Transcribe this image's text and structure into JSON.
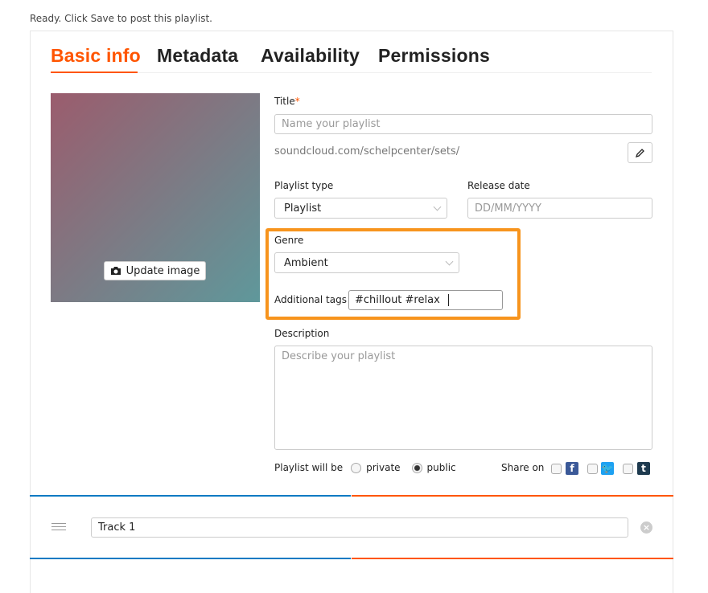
{
  "status": "Ready. Click Save to post this playlist.",
  "tabs": [
    {
      "label": "Basic info",
      "active": true
    },
    {
      "label": "Metadata"
    },
    {
      "label": "Availability"
    },
    {
      "label": "Permissions"
    }
  ],
  "image": {
    "update_label": "Update image",
    "icon": "camera-icon"
  },
  "title": {
    "label": "Title",
    "required": "*",
    "placeholder": "Name your playlist",
    "value": ""
  },
  "url": {
    "text": "soundcloud.com/schelpcenter/sets/",
    "edit_icon": "pencil-icon"
  },
  "playlist_type": {
    "label": "Playlist type",
    "value": "Playlist"
  },
  "release_date": {
    "label": "Release date",
    "placeholder": "DD/MM/YYYY"
  },
  "genre": {
    "label": "Genre",
    "value": "Ambient"
  },
  "tags": {
    "label": "Additional tags",
    "value": "#chillout #relax"
  },
  "description": {
    "label": "Description",
    "placeholder": "Describe your playlist"
  },
  "privacy": {
    "label": "Playlist will be",
    "options": [
      "private",
      "public"
    ],
    "selected": "public"
  },
  "share": {
    "label": "Share on",
    "networks": [
      {
        "name": "facebook",
        "glyph": "f",
        "color": "#3b5998"
      },
      {
        "name": "twitter",
        "glyph": "t",
        "color": "#1da1f2"
      },
      {
        "name": "tumblr",
        "glyph": "t",
        "color": "#1e3a4f"
      }
    ]
  },
  "tracks": [
    {
      "value": "Track 1"
    }
  ],
  "colors": {
    "accent": "#ff5500",
    "highlight": "#f7941d",
    "blue": "#0b7ac3"
  }
}
